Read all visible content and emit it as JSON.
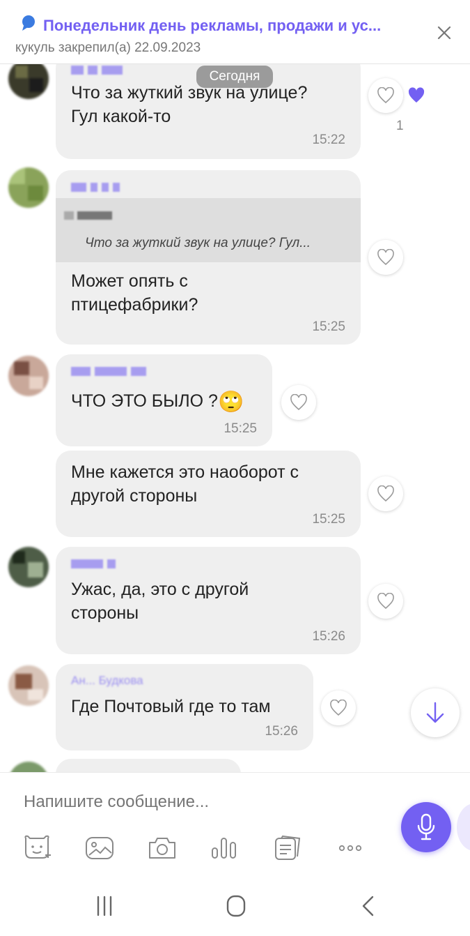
{
  "pinned": {
    "title": "Понедельник день рекламы, продажи и ус...",
    "subtitle": "кукуль закрепил(а) 22.09.2023"
  },
  "date_separator": "Сегодня",
  "messages": [
    {
      "text_lines": [
        "Что за жуткий звук на улице?",
        "Гул какой-то"
      ],
      "time": "15:22",
      "reaction_count": "1"
    },
    {
      "quote_author": "И.",
      "quote_text": "Что за жуткий звук на улице? Гул...",
      "text_lines": [
        "Может опять с",
        "птицефабрики?"
      ],
      "time": "15:25"
    },
    {
      "text_lines": [
        "ЧТО ЭТО БЫЛО ?"
      ],
      "emoji": "🙄",
      "time": "15:25"
    },
    {
      "text_lines": [
        "Мне кажется это наоборот с",
        "другой стороны"
      ],
      "time": "15:25"
    },
    {
      "text_lines": [
        "Ужас, да, это с другой",
        "стороны"
      ],
      "time": "15:26"
    },
    {
      "sender": "Ан... Будкова",
      "text_lines": [
        "Где Почтовый где то там"
      ],
      "time": "15:26"
    }
  ],
  "composer": {
    "placeholder": "Напишите сообщение..."
  },
  "icons": {
    "pin": "pin-icon",
    "close": "close-icon",
    "heart": "heart-icon",
    "scroll_down": "arrow-down-icon",
    "mic": "microphone-icon",
    "sticker": "sticker-icon",
    "gallery": "gallery-icon",
    "camera": "camera-icon",
    "poll": "poll-icon",
    "gif": "gif-icon",
    "more": "more-icon",
    "recents": "recents-icon",
    "home": "home-icon",
    "back": "back-icon"
  },
  "colors": {
    "accent": "#7360f2",
    "bubble": "#efefef",
    "time": "#8a8a8a"
  }
}
